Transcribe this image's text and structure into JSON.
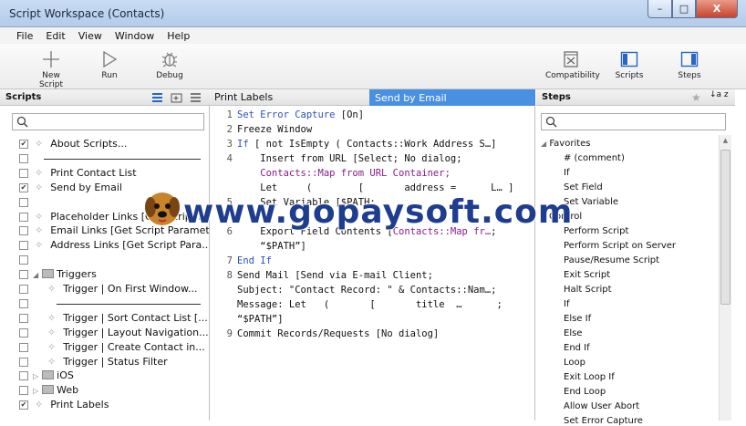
{
  "window": {
    "title": "Script Workspace (Contacts)",
    "min": "–",
    "max": "□",
    "close": "X"
  },
  "menu": [
    "File",
    "Edit",
    "View",
    "Window",
    "Help"
  ],
  "toolbar": {
    "new_script": "New Script",
    "run": "Run",
    "debug": "Debug",
    "compatibility": "Compatibility",
    "scripts": "Scripts",
    "steps": "Steps"
  },
  "scripts_panel": {
    "header": "Scripts",
    "items": [
      {
        "label": "About Scripts...",
        "checked": true,
        "kind": "script",
        "indent": 0
      },
      {
        "label": "",
        "checked": false,
        "kind": "separator",
        "indent": 0
      },
      {
        "label": "Print Contact List",
        "checked": false,
        "kind": "script",
        "indent": 0
      },
      {
        "label": "Send by Email",
        "checked": true,
        "kind": "script",
        "indent": 0
      },
      {
        "label": "",
        "checked": false,
        "kind": "blank",
        "indent": 0
      },
      {
        "label": "Placeholder Links [Get Script P...",
        "checked": false,
        "kind": "script",
        "indent": 0
      },
      {
        "label": "Email Links [Get Script Paramet...",
        "checked": false,
        "kind": "script",
        "indent": 0
      },
      {
        "label": "Address Links [Get Script Para...",
        "checked": false,
        "kind": "script",
        "indent": 0
      },
      {
        "label": "",
        "checked": false,
        "kind": "blank",
        "indent": 0
      },
      {
        "label": "Triggers",
        "checked": false,
        "kind": "folder-open",
        "indent": 0
      },
      {
        "label": "Trigger | On First Window...",
        "checked": false,
        "kind": "script",
        "indent": 1
      },
      {
        "label": "",
        "checked": false,
        "kind": "separator",
        "indent": 1
      },
      {
        "label": "Trigger | Sort Contact List [...",
        "checked": false,
        "kind": "script",
        "indent": 1
      },
      {
        "label": "Trigger | Layout Navigation...",
        "checked": false,
        "kind": "script",
        "indent": 1
      },
      {
        "label": "Trigger | Create Contact in...",
        "checked": false,
        "kind": "script",
        "indent": 1
      },
      {
        "label": "Trigger | Status Filter",
        "checked": false,
        "kind": "script",
        "indent": 1
      },
      {
        "label": "iOS",
        "checked": false,
        "kind": "folder",
        "indent": 0
      },
      {
        "label": "Web",
        "checked": false,
        "kind": "folder",
        "indent": 0
      },
      {
        "label": "Print Labels",
        "checked": true,
        "kind": "script",
        "indent": 0
      }
    ]
  },
  "tabs": [
    {
      "label": "Print Labels",
      "active": false
    },
    {
      "label": "Send by Email",
      "active": true
    }
  ],
  "editor_lines": [
    {
      "num": "1",
      "segments": [
        {
          "t": "Set Error Capture",
          "c": "#2b50c8"
        },
        {
          "t": " [On]",
          "c": "#111"
        }
      ]
    },
    {
      "num": "2",
      "segments": [
        {
          "t": "Freeze Window",
          "c": "#111"
        }
      ]
    },
    {
      "num": "3",
      "segments": [
        {
          "t": "If",
          "c": "#2b50c8"
        },
        {
          "t": " [ not IsEmpty ( Contacts::Work Address S…]",
          "c": "#111"
        }
      ]
    },
    {
      "num": "4",
      "segments": [
        {
          "t": "    Insert from URL [Select; No dialog;",
          "c": "#111"
        }
      ]
    },
    {
      "num": "",
      "segments": [
        {
          "t": "    Contacts::Map from URL Container;",
          "c": "#8b1a8b"
        }
      ]
    },
    {
      "num": "",
      "segments": [
        {
          "t": "    Let     (        [       address =      L… ]",
          "c": "#111"
        }
      ]
    },
    {
      "num": "5",
      "segments": [
        {
          "t": "    Set Variable [$PATH;",
          "c": "#111"
        }
      ]
    },
    {
      "num": "",
      "segments": [
        {
          "t": "",
          "c": "#111"
        }
      ]
    },
    {
      "num": "6",
      "segments": [
        {
          "t": "    Export Field Contents [",
          "c": "#111"
        },
        {
          "t": "Contacts::Map fr…",
          "c": "#8b1a8b"
        },
        {
          "t": ";",
          "c": "#111"
        }
      ]
    },
    {
      "num": "",
      "segments": [
        {
          "t": "    “$PATH”]",
          "c": "#111"
        }
      ]
    },
    {
      "num": "7",
      "segments": [
        {
          "t": "End If",
          "c": "#2b50c8"
        }
      ]
    },
    {
      "num": "8",
      "segments": [
        {
          "t": "Send Mail [Send via E-mail Client;",
          "c": "#111"
        }
      ]
    },
    {
      "num": "",
      "segments": [
        {
          "t": "Subject: \"Contact Record: \" & Contacts::Nam…;",
          "c": "#111"
        }
      ]
    },
    {
      "num": "",
      "segments": [
        {
          "t": "Message: Let   (       [       title  …      ;",
          "c": "#111"
        }
      ]
    },
    {
      "num": "",
      "segments": [
        {
          "t": "“$PATH”]",
          "c": "#111"
        }
      ]
    },
    {
      "num": "9",
      "segments": [
        {
          "t": "Commit Records/Requests [No dialog]",
          "c": "#111"
        }
      ]
    }
  ],
  "steps_panel": {
    "header": "Steps",
    "sort_icon": "↓a z",
    "group": "Favorites",
    "items": [
      "# (comment)",
      "If",
      "Set Field",
      "Set Variable",
      "Control",
      "Perform Script",
      "Perform Script on Server",
      "Pause/Resume Script",
      "Exit Script",
      "Halt Script",
      "If",
      "Else If",
      "Else",
      "End If",
      "Loop",
      "Exit Loop If",
      "End Loop",
      "Allow User Abort",
      "Set Error Capture"
    ]
  },
  "watermark": "www.gopaysoft.com",
  "colors": {
    "tab_active": "#4a90e2",
    "keyword": "#2b50c8",
    "field": "#8b1a8b"
  }
}
